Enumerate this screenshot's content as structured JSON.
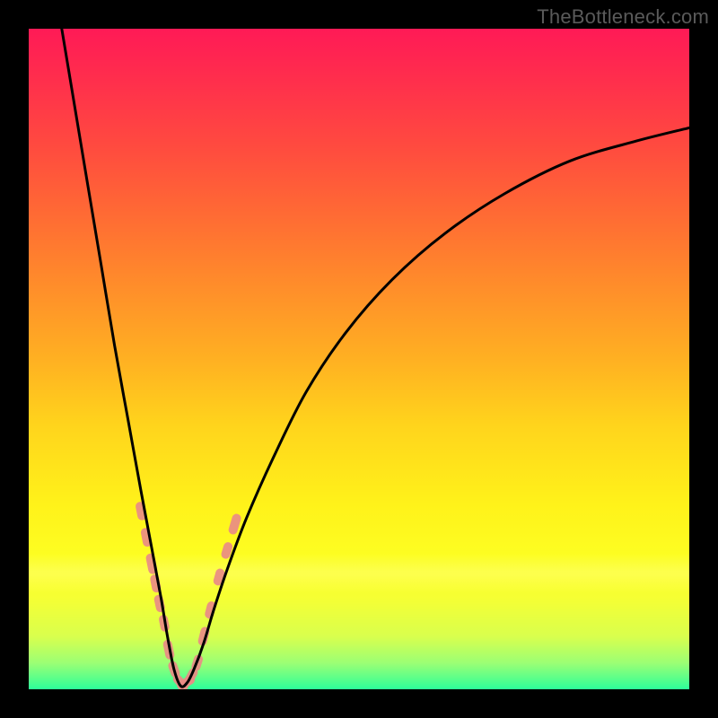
{
  "attribution": "TheBottleneck.com",
  "colors": {
    "frame": "#000000",
    "curve": "#000000",
    "markers": "#e98b86",
    "gradient_top": "#ff1a56",
    "gradient_bottom": "#2dff9a"
  },
  "chart_data": {
    "type": "line",
    "title": "",
    "xlabel": "",
    "ylabel": "",
    "xlim": [
      0,
      100
    ],
    "ylim": [
      0,
      100
    ],
    "note": "No numeric axes shown; x/y are percentage of plot area (0 left/bottom, 100 right/top). The curve is a V-shaped bottleneck curve bottoming near x≈23.",
    "series": [
      {
        "name": "bottleneck-curve",
        "x": [
          5,
          7,
          9,
          11,
          13,
          15,
          17,
          18.5,
          20,
          21,
          22,
          23,
          24,
          25,
          26.5,
          28,
          30,
          33,
          37,
          42,
          48,
          55,
          63,
          72,
          82,
          92,
          100
        ],
        "y": [
          100,
          88,
          76,
          64,
          52,
          41,
          30,
          22,
          14,
          8,
          3,
          0.5,
          1,
          3,
          7,
          12,
          18,
          26,
          35,
          45,
          54,
          62,
          69,
          75,
          80,
          83,
          85
        ]
      }
    ],
    "markers": {
      "name": "highlighted-points",
      "note": "Pink dot/segment markers clustered around the V bottom (approx. 10–25% height on each arm).",
      "points": [
        {
          "x": 17.0,
          "y": 27
        },
        {
          "x": 17.8,
          "y": 23
        },
        {
          "x": 18.6,
          "y": 19
        },
        {
          "x": 19.2,
          "y": 16
        },
        {
          "x": 19.8,
          "y": 13
        },
        {
          "x": 20.5,
          "y": 10
        },
        {
          "x": 21.2,
          "y": 6
        },
        {
          "x": 22.0,
          "y": 3
        },
        {
          "x": 23.0,
          "y": 1
        },
        {
          "x": 23.8,
          "y": 1
        },
        {
          "x": 24.6,
          "y": 2
        },
        {
          "x": 25.5,
          "y": 4
        },
        {
          "x": 26.5,
          "y": 8
        },
        {
          "x": 27.5,
          "y": 12
        },
        {
          "x": 28.8,
          "y": 17
        },
        {
          "x": 30.0,
          "y": 21
        },
        {
          "x": 31.2,
          "y": 25
        }
      ]
    }
  }
}
